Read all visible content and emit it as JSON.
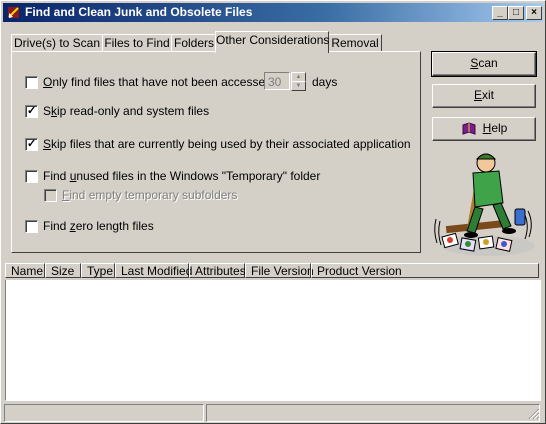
{
  "window": {
    "title": "Find and Clean Junk and Obsolete Files",
    "controls": {
      "minimize": "_",
      "maximize": "□",
      "close": "×"
    }
  },
  "tabs": [
    {
      "label": "Drive(s) to Scan"
    },
    {
      "label": "Files to Find"
    },
    {
      "label": "Folders"
    },
    {
      "label": "Other Considerations"
    },
    {
      "label": "Removal"
    }
  ],
  "active_tab": "Other Considerations",
  "options": {
    "access_days": {
      "pre": "",
      "u": "O",
      "post": "nly find files that have not been accessed in",
      "checked": false,
      "days_value": "30",
      "days_label": "days"
    },
    "skip_readonly": {
      "pre": "S",
      "u": "k",
      "post": "ip read-only and system files",
      "checked": true
    },
    "skip_in_use": {
      "pre": "",
      "u": "S",
      "post": "kip files that are currently being used by their associated application",
      "checked": true
    },
    "find_temp": {
      "pre": "Find ",
      "u": "u",
      "post": "nused files in the Windows \"Temporary\" folder",
      "checked": false
    },
    "find_empty_temp": {
      "pre": "",
      "u": "F",
      "post": "ind empty temporary subfolders",
      "checked": false,
      "disabled": true
    },
    "find_zero": {
      "pre": "Find ",
      "u": "z",
      "post": "ero length files",
      "checked": false
    }
  },
  "buttons": {
    "scan": {
      "u": "S",
      "post": "can"
    },
    "exit": {
      "u": "E",
      "post": "xit"
    },
    "help": {
      "u": "H",
      "post": "elp"
    }
  },
  "columns": [
    "Name",
    "Size",
    "Type",
    "Last Modified",
    "Attributes",
    "File Version",
    "Product Version"
  ],
  "icons": {
    "app": "broom-icon",
    "help": "book-icon",
    "illustration": "cleaner-mascot-illustration"
  }
}
